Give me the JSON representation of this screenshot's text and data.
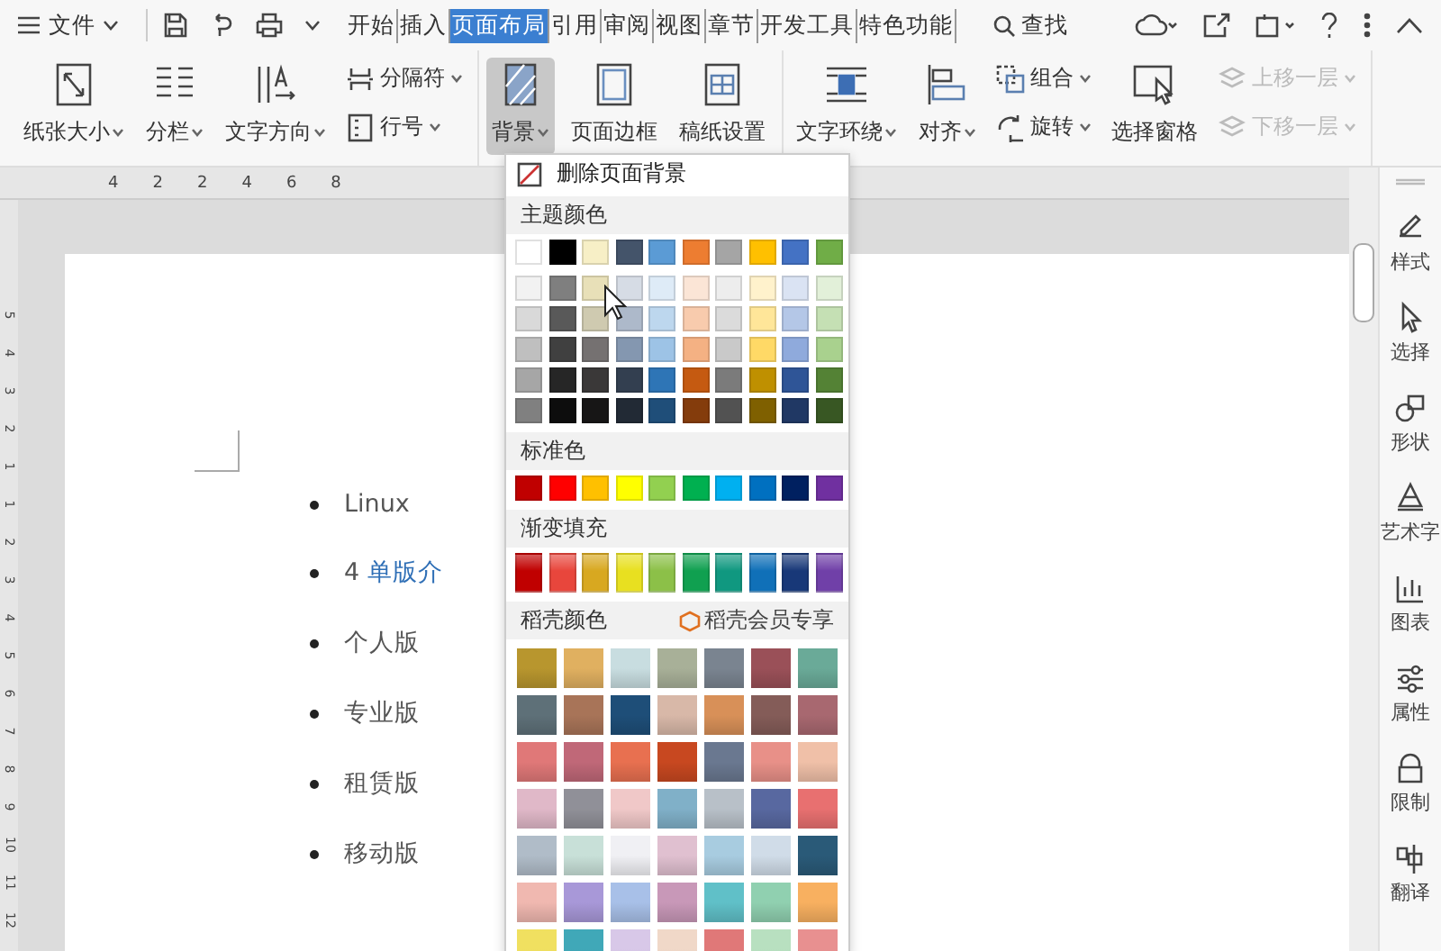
{
  "menubar": {
    "file_menu": "文件",
    "tabs": [
      {
        "label": "开始",
        "selected": false
      },
      {
        "label": "插入",
        "selected": false
      },
      {
        "label": "页面布局",
        "selected": true
      },
      {
        "label": "引用",
        "selected": false
      },
      {
        "label": "审阅",
        "selected": false
      },
      {
        "label": "视图",
        "selected": false
      },
      {
        "label": "章节",
        "selected": false
      },
      {
        "label": "开发工具",
        "selected": false
      },
      {
        "label": "特色功能",
        "selected": false
      }
    ],
    "search": "查找"
  },
  "ribbon": {
    "groups": [
      {
        "items": [
          {
            "kind": "large",
            "label": "纸张大小",
            "dropdown": true,
            "pressed": false,
            "disabled": false
          },
          {
            "kind": "large",
            "label": "分栏",
            "dropdown": true,
            "pressed": false,
            "disabled": false
          },
          {
            "kind": "large",
            "label": "文字方向",
            "dropdown": true,
            "pressed": false,
            "disabled": false
          },
          {
            "kind": "stack",
            "items": [
              {
                "label": "分隔符",
                "dropdown": true,
                "disabled": false
              },
              {
                "label": "行号",
                "dropdown": true,
                "disabled": false
              }
            ]
          }
        ]
      },
      {
        "items": [
          {
            "kind": "large",
            "label": "背景",
            "dropdown": true,
            "pressed": true,
            "disabled": false
          },
          {
            "kind": "large",
            "label": "页面边框",
            "dropdown": false,
            "pressed": false,
            "disabled": false
          },
          {
            "kind": "large",
            "label": "稿纸设置",
            "dropdown": false,
            "pressed": false,
            "disabled": false
          }
        ]
      },
      {
        "items": [
          {
            "kind": "large",
            "label": "文字环绕",
            "dropdown": true,
            "pressed": false,
            "disabled": false
          },
          {
            "kind": "large",
            "label": "对齐",
            "dropdown": true,
            "pressed": false,
            "disabled": false
          },
          {
            "kind": "stack",
            "items": [
              {
                "label": "组合",
                "dropdown": true,
                "disabled": false
              },
              {
                "label": "旋转",
                "dropdown": true,
                "disabled": false
              }
            ]
          },
          {
            "kind": "large",
            "label": "选择窗格",
            "dropdown": false,
            "pressed": false,
            "disabled": false
          },
          {
            "kind": "stack",
            "items": [
              {
                "label": "上移一层",
                "dropdown": true,
                "disabled": true
              },
              {
                "label": "下移一层",
                "dropdown": true,
                "disabled": true
              }
            ]
          }
        ]
      }
    ]
  },
  "ruler": {
    "numbers": [
      "4",
      "2",
      "2",
      "4",
      "6",
      "8"
    ],
    "vertical_numbers": [
      "5",
      "4",
      "3",
      "2",
      "1",
      "1",
      "2",
      "3",
      "4",
      "5",
      "6",
      "7",
      "8",
      "9",
      "10",
      "11",
      "12"
    ]
  },
  "document": {
    "items": [
      {
        "text": "Linux"
      },
      {
        "text": "4 **单版介**"
      },
      {
        "text": "个人版"
      },
      {
        "text": "专业版"
      },
      {
        "text": "租赁版"
      },
      {
        "text": "移动版"
      }
    ]
  },
  "background_menu": {
    "remove": "删除页面背景",
    "theme_title": "主题颜色",
    "theme_top": [
      {
        "color": "#ffffff"
      },
      {
        "color": "#000000"
      },
      {
        "color": "#f7efc6"
      },
      {
        "color": "#44546a"
      },
      {
        "color": "#5b9bd5"
      },
      {
        "color": "#ed7d31"
      },
      {
        "color": "#a5a5a5"
      },
      {
        "color": "#ffc000"
      },
      {
        "color": "#4472c4"
      },
      {
        "color": "#70ad47"
      }
    ],
    "theme_shades": [
      [
        {
          "color": "#f2f2f2"
        },
        {
          "color": "#7f7f7f"
        },
        {
          "color": "#e8e0b8"
        },
        {
          "color": "#d6dce5"
        },
        {
          "color": "#deebf7"
        },
        {
          "color": "#fbe5d6"
        },
        {
          "color": "#ededed"
        },
        {
          "color": "#fff2cc"
        },
        {
          "color": "#dae3f3"
        },
        {
          "color": "#e2f0d9"
        }
      ],
      [
        {
          "color": "#d9d9d9"
        },
        {
          "color": "#595959"
        },
        {
          "color": "#cfcab0"
        },
        {
          "color": "#adb9ca"
        },
        {
          "color": "#bdd7ee"
        },
        {
          "color": "#f8cbad"
        },
        {
          "color": "#dbdbdb"
        },
        {
          "color": "#ffe699"
        },
        {
          "color": "#b4c7e7"
        },
        {
          "color": "#c5e0b4"
        }
      ],
      [
        {
          "color": "#bfbfbf"
        },
        {
          "color": "#404040"
        },
        {
          "color": "#757171"
        },
        {
          "color": "#8497b0"
        },
        {
          "color": "#9dc3e6"
        },
        {
          "color": "#f4b183"
        },
        {
          "color": "#c9c9c9"
        },
        {
          "color": "#ffd966"
        },
        {
          "color": "#8faadc"
        },
        {
          "color": "#a9d18e"
        }
      ],
      [
        {
          "color": "#a6a6a6"
        },
        {
          "color": "#262626"
        },
        {
          "color": "#3a3838"
        },
        {
          "color": "#333f50"
        },
        {
          "color": "#2e75b6"
        },
        {
          "color": "#c55a11"
        },
        {
          "color": "#7b7b7b"
        },
        {
          "color": "#bf9000"
        },
        {
          "color": "#2f5597"
        },
        {
          "color": "#548235"
        }
      ],
      [
        {
          "color": "#808080"
        },
        {
          "color": "#0d0d0d"
        },
        {
          "color": "#171616"
        },
        {
          "color": "#222a35"
        },
        {
          "color": "#1f4e79"
        },
        {
          "color": "#843c0c"
        },
        {
          "color": "#525252"
        },
        {
          "color": "#7f6000"
        },
        {
          "color": "#203864"
        },
        {
          "color": "#385723"
        }
      ]
    ],
    "standard_title": "标准色",
    "standard": [
      {
        "color": "#c00000"
      },
      {
        "color": "#ff0000"
      },
      {
        "color": "#ffc000"
      },
      {
        "color": "#ffff00"
      },
      {
        "color": "#92d050"
      },
      {
        "color": "#00b050"
      },
      {
        "color": "#00b0f0"
      },
      {
        "color": "#0070c0"
      },
      {
        "color": "#002060"
      },
      {
        "color": "#7030a0"
      }
    ],
    "gradient_title": "渐变填充",
    "gradient": [
      {
        "color": "#c00000"
      },
      {
        "color": "#e8463c"
      },
      {
        "color": "#d8a820"
      },
      {
        "color": "#e8e020"
      },
      {
        "color": "#8cc048"
      },
      {
        "color": "#10a050"
      },
      {
        "color": "#109880"
      },
      {
        "color": "#1070b8"
      },
      {
        "color": "#183878"
      },
      {
        "color": "#7040a8"
      }
    ],
    "docer_title": "稻壳颜色",
    "docer_member": "稻壳会员专享",
    "docer": [
      [
        {
          "color": "#b8962e"
        },
        {
          "color": "#e0b060"
        },
        {
          "color": "#c8dde0"
        },
        {
          "color": "#a8b098"
        },
        {
          "color": "#7a8490"
        },
        {
          "color": "#9a5058"
        },
        {
          "color": "#6aaa98"
        }
      ],
      [
        {
          "color": "#5e7078"
        },
        {
          "color": "#a87458"
        },
        {
          "color": "#1e4e78"
        },
        {
          "color": "#d8b8a8"
        },
        {
          "color": "#d89058"
        },
        {
          "color": "#845c58"
        },
        {
          "color": "#a86870"
        }
      ],
      [
        {
          "color": "#e07878"
        },
        {
          "color": "#c06878"
        },
        {
          "color": "#e87050"
        },
        {
          "color": "#c84820"
        },
        {
          "color": "#6a7890"
        },
        {
          "color": "#e89088"
        },
        {
          "color": "#f0c0a8"
        }
      ],
      [
        {
          "color": "#e0b8c8"
        },
        {
          "color": "#909098"
        },
        {
          "color": "#f0c8c8"
        },
        {
          "color": "#80b0c8"
        },
        {
          "color": "#b8c0c8"
        },
        {
          "color": "#5868a0"
        },
        {
          "color": "#e87070"
        }
      ],
      [
        {
          "color": "#b0bcc8"
        },
        {
          "color": "#c8e0d8"
        },
        {
          "color": "#f0f0f4"
        },
        {
          "color": "#e0c0d0"
        },
        {
          "color": "#a8cce0"
        },
        {
          "color": "#d0dce8"
        },
        {
          "color": "#2a5a78"
        }
      ],
      [
        {
          "color": "#f0b8b0"
        },
        {
          "color": "#a898d8"
        },
        {
          "color": "#a8c0e8"
        },
        {
          "color": "#c898b8"
        },
        {
          "color": "#60c0c8"
        },
        {
          "color": "#90d0b0"
        },
        {
          "color": "#f8b060"
        }
      ],
      [
        {
          "color": "#f0e060"
        },
        {
          "color": "#40a8b8"
        },
        {
          "color": "#d8c8e8"
        },
        {
          "color": "#f0d8c8"
        },
        {
          "color": "#e07878"
        },
        {
          "color": "#b8e0c0"
        },
        {
          "color": "#e89090"
        }
      ]
    ]
  },
  "side_panel": [
    {
      "label": "样式"
    },
    {
      "label": "选择"
    },
    {
      "label": "形状"
    },
    {
      "label": "艺术字"
    },
    {
      "label": "图表"
    },
    {
      "label": "属性"
    },
    {
      "label": "限制"
    },
    {
      "label": "翻译"
    }
  ]
}
